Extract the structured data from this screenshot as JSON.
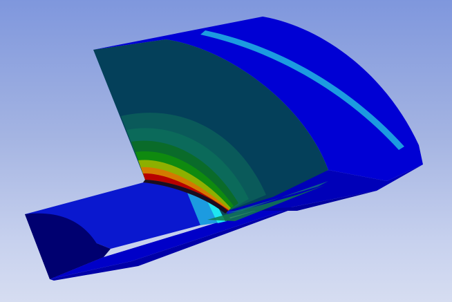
{
  "viewport": {
    "background_top": "#7f97dd",
    "background_bottom": "#d6ddf1"
  },
  "model": {
    "description_icon": "fea-contour-model",
    "colors": {
      "dark_blue": "#00006e",
      "blue": "#0000d8",
      "light_blue": "#1c9be0",
      "cyan": "#1ee6ef",
      "teal_dark": "#04405a",
      "teal": "#0a5a5a",
      "teal_mid": "#0b6a5a",
      "green_dark": "#0a6b2a",
      "green": "#0f8a0f",
      "yellow_green": "#8db000",
      "orange": "#d47a00",
      "red": "#b80000"
    }
  }
}
